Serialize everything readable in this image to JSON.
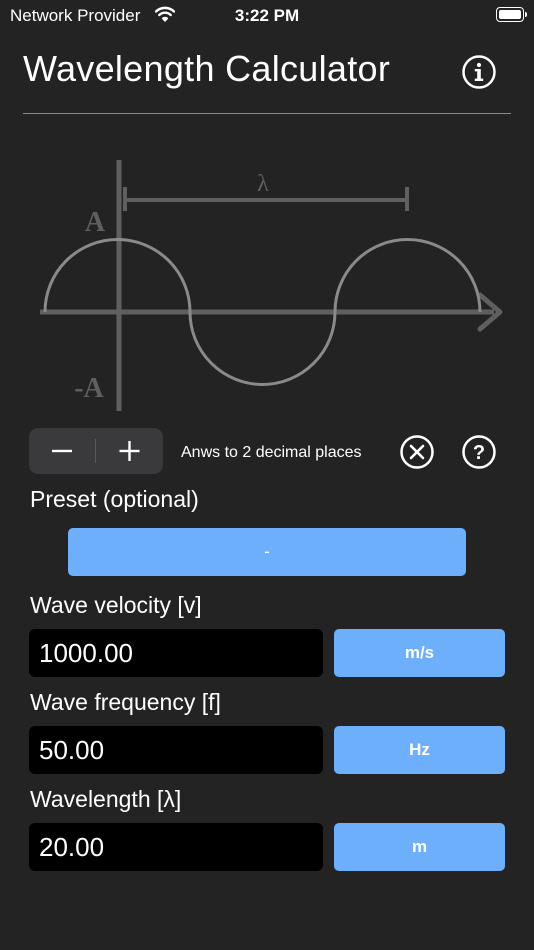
{
  "status_bar": {
    "carrier": "Network Provider",
    "time": "3:22 PM"
  },
  "header": {
    "title": "Wavelength Calculator",
    "info_icon": "info-circle-icon"
  },
  "diagram": {
    "lambda_label": "λ",
    "amplitude_label": "A",
    "neg_amplitude_label": "-A"
  },
  "controls": {
    "minus_label": "−",
    "plus_label": "+",
    "precision_text": "Anws to 2 decimal places",
    "clear_icon": "x-circle-icon",
    "help_icon": "question-circle-icon"
  },
  "preset": {
    "label": "Preset (optional)",
    "value": "-"
  },
  "velocity": {
    "label": "Wave velocity [v]",
    "value": "1000.00",
    "unit": "m/s"
  },
  "frequency": {
    "label": "Wave frequency [f]",
    "value": "50.00",
    "unit": "Hz"
  },
  "wavelength": {
    "label": "Wavelength [λ]",
    "value": "20.00",
    "unit": "m"
  },
  "colors": {
    "accent": "#6eaffc",
    "background": "#232323",
    "field": "#000000"
  }
}
